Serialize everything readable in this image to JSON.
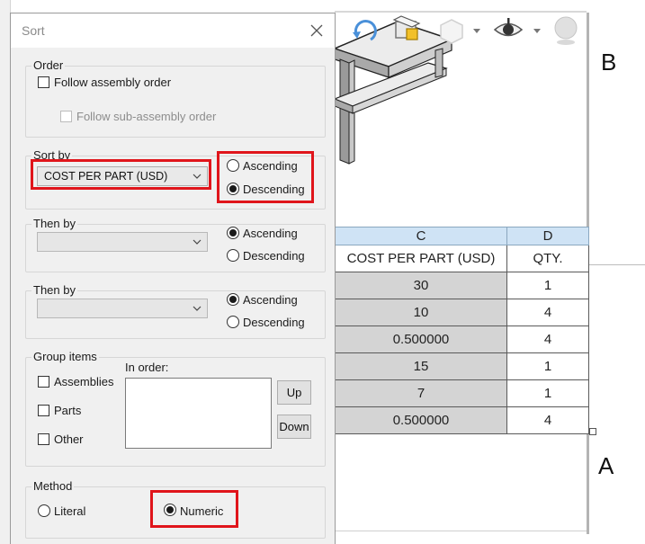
{
  "dialog": {
    "title": "Sort",
    "order": {
      "label": "Order",
      "follow_assembly": "Follow assembly order",
      "follow_subassembly": "Follow sub-assembly order"
    },
    "sort_by": {
      "label": "Sort by",
      "value": "COST PER PART (USD)",
      "ascending": "Ascending",
      "descending": "Descending",
      "selected": "Descending"
    },
    "then_by_1": {
      "label": "Then by",
      "value": "",
      "ascending": "Ascending",
      "descending": "Descending",
      "selected": "Ascending"
    },
    "then_by_2": {
      "label": "Then by",
      "value": "",
      "ascending": "Ascending",
      "descending": "Descending",
      "selected": "Ascending"
    },
    "group_items": {
      "label": "Group items",
      "in_order": "In order:",
      "assemblies": "Assemblies",
      "parts": "Parts",
      "other": "Other",
      "up": "Up",
      "down": "Down"
    },
    "method": {
      "label": "Method",
      "literal": "Literal",
      "numeric": "Numeric",
      "selected": "Numeric"
    }
  },
  "drawing": {
    "zone_top": "B",
    "zone_bottom": "A",
    "bom": {
      "column_letters": [
        "C",
        "D"
      ],
      "headers": [
        "COST PER PART (USD)",
        "QTY."
      ],
      "rows": [
        [
          "30",
          "1"
        ],
        [
          "10",
          "4"
        ],
        [
          "0.500000",
          "4"
        ],
        [
          "15",
          "1"
        ],
        [
          "7",
          "1"
        ],
        [
          "0.500000",
          "4"
        ]
      ]
    }
  },
  "colors": {
    "highlight": "#e0151b",
    "column_header": "#cfe3f5",
    "selected_cell": "#d4d4d4"
  },
  "icons": [
    "rotate-view-icon",
    "part-icon",
    "view-orientation-icon",
    "hide-show-icon",
    "appearance-icon",
    "close-icon",
    "chevron-down-icon"
  ]
}
